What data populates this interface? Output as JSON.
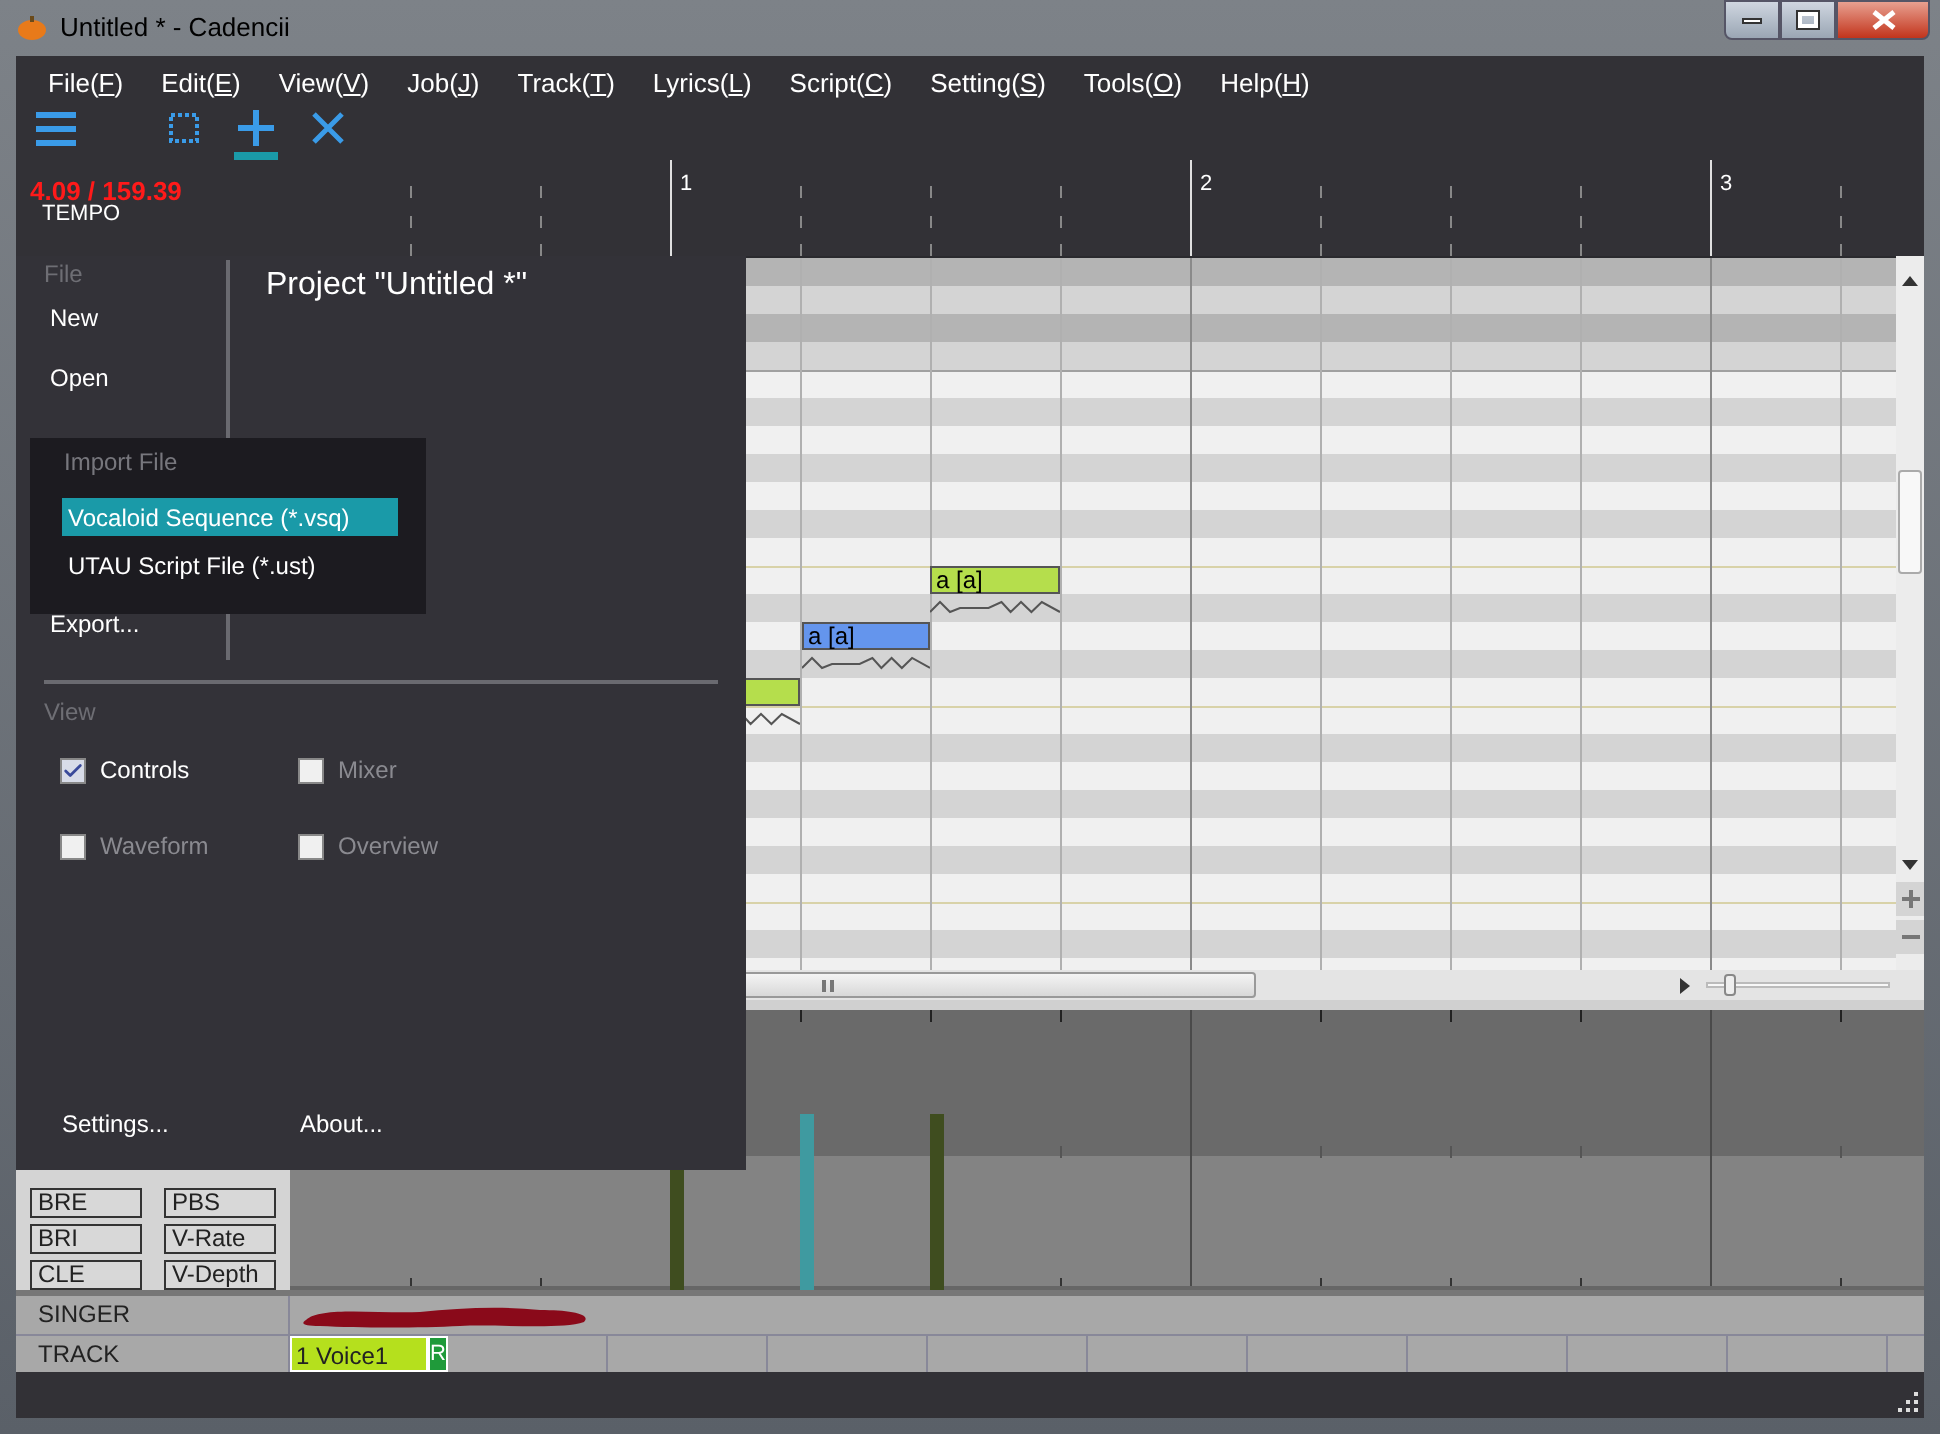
{
  "window": {
    "title": "Untitled * - Cadencii"
  },
  "menu_bar": [
    "File(F)",
    "Edit(E)",
    "View(V)",
    "Job(J)",
    "Track(T)",
    "Lyrics(L)",
    "Script(C)",
    "Setting(S)",
    "Tools(O)",
    "Help(H)"
  ],
  "toolbar": [
    {
      "kind": "menu",
      "selected": false
    },
    {
      "kind": "select",
      "selected": false
    },
    {
      "kind": "add",
      "selected": true
    },
    {
      "kind": "erase",
      "selected": false
    }
  ],
  "ruler": {
    "position": "4.09 / 159.39",
    "tempo_label": "TEMPO",
    "bars": [
      "1",
      "2",
      "3"
    ]
  },
  "notes": [
    {
      "selected": false
    },
    {
      "lyric": "a [a]",
      "selected": true
    },
    {
      "lyric": "a [a]",
      "selected": false
    }
  ],
  "zoom_slider": {
    "level": 0.1
  },
  "curve_buttons": [
    "BRE",
    "PBS",
    "BRI",
    "V-Rate",
    "CLE",
    "V-Depth"
  ],
  "singer": {
    "label": "SINGER"
  },
  "track": {
    "label": "TRACK",
    "tabs": [
      {
        "name": "1 Voice1",
        "badge": "R",
        "selected": true
      }
    ]
  },
  "file_menu": {
    "section": "File",
    "items": [
      "New",
      "Open",
      "Export..."
    ],
    "project_title": "Project \"Untitled *\"",
    "view_section": "View",
    "view_options": [
      {
        "label": "Controls",
        "checked": true
      },
      {
        "label": "Mixer",
        "checked": false
      },
      {
        "label": "Waveform",
        "checked": false
      },
      {
        "label": "Overview",
        "checked": false
      }
    ],
    "footer": [
      "Settings...",
      "About..."
    ]
  },
  "import_submenu": {
    "title": "Import File",
    "items": [
      {
        "label": "Vocaloid Sequence (*.vsq)",
        "selected": true
      },
      {
        "label": "UTAU Script File (*.ust)",
        "selected": false
      }
    ]
  }
}
